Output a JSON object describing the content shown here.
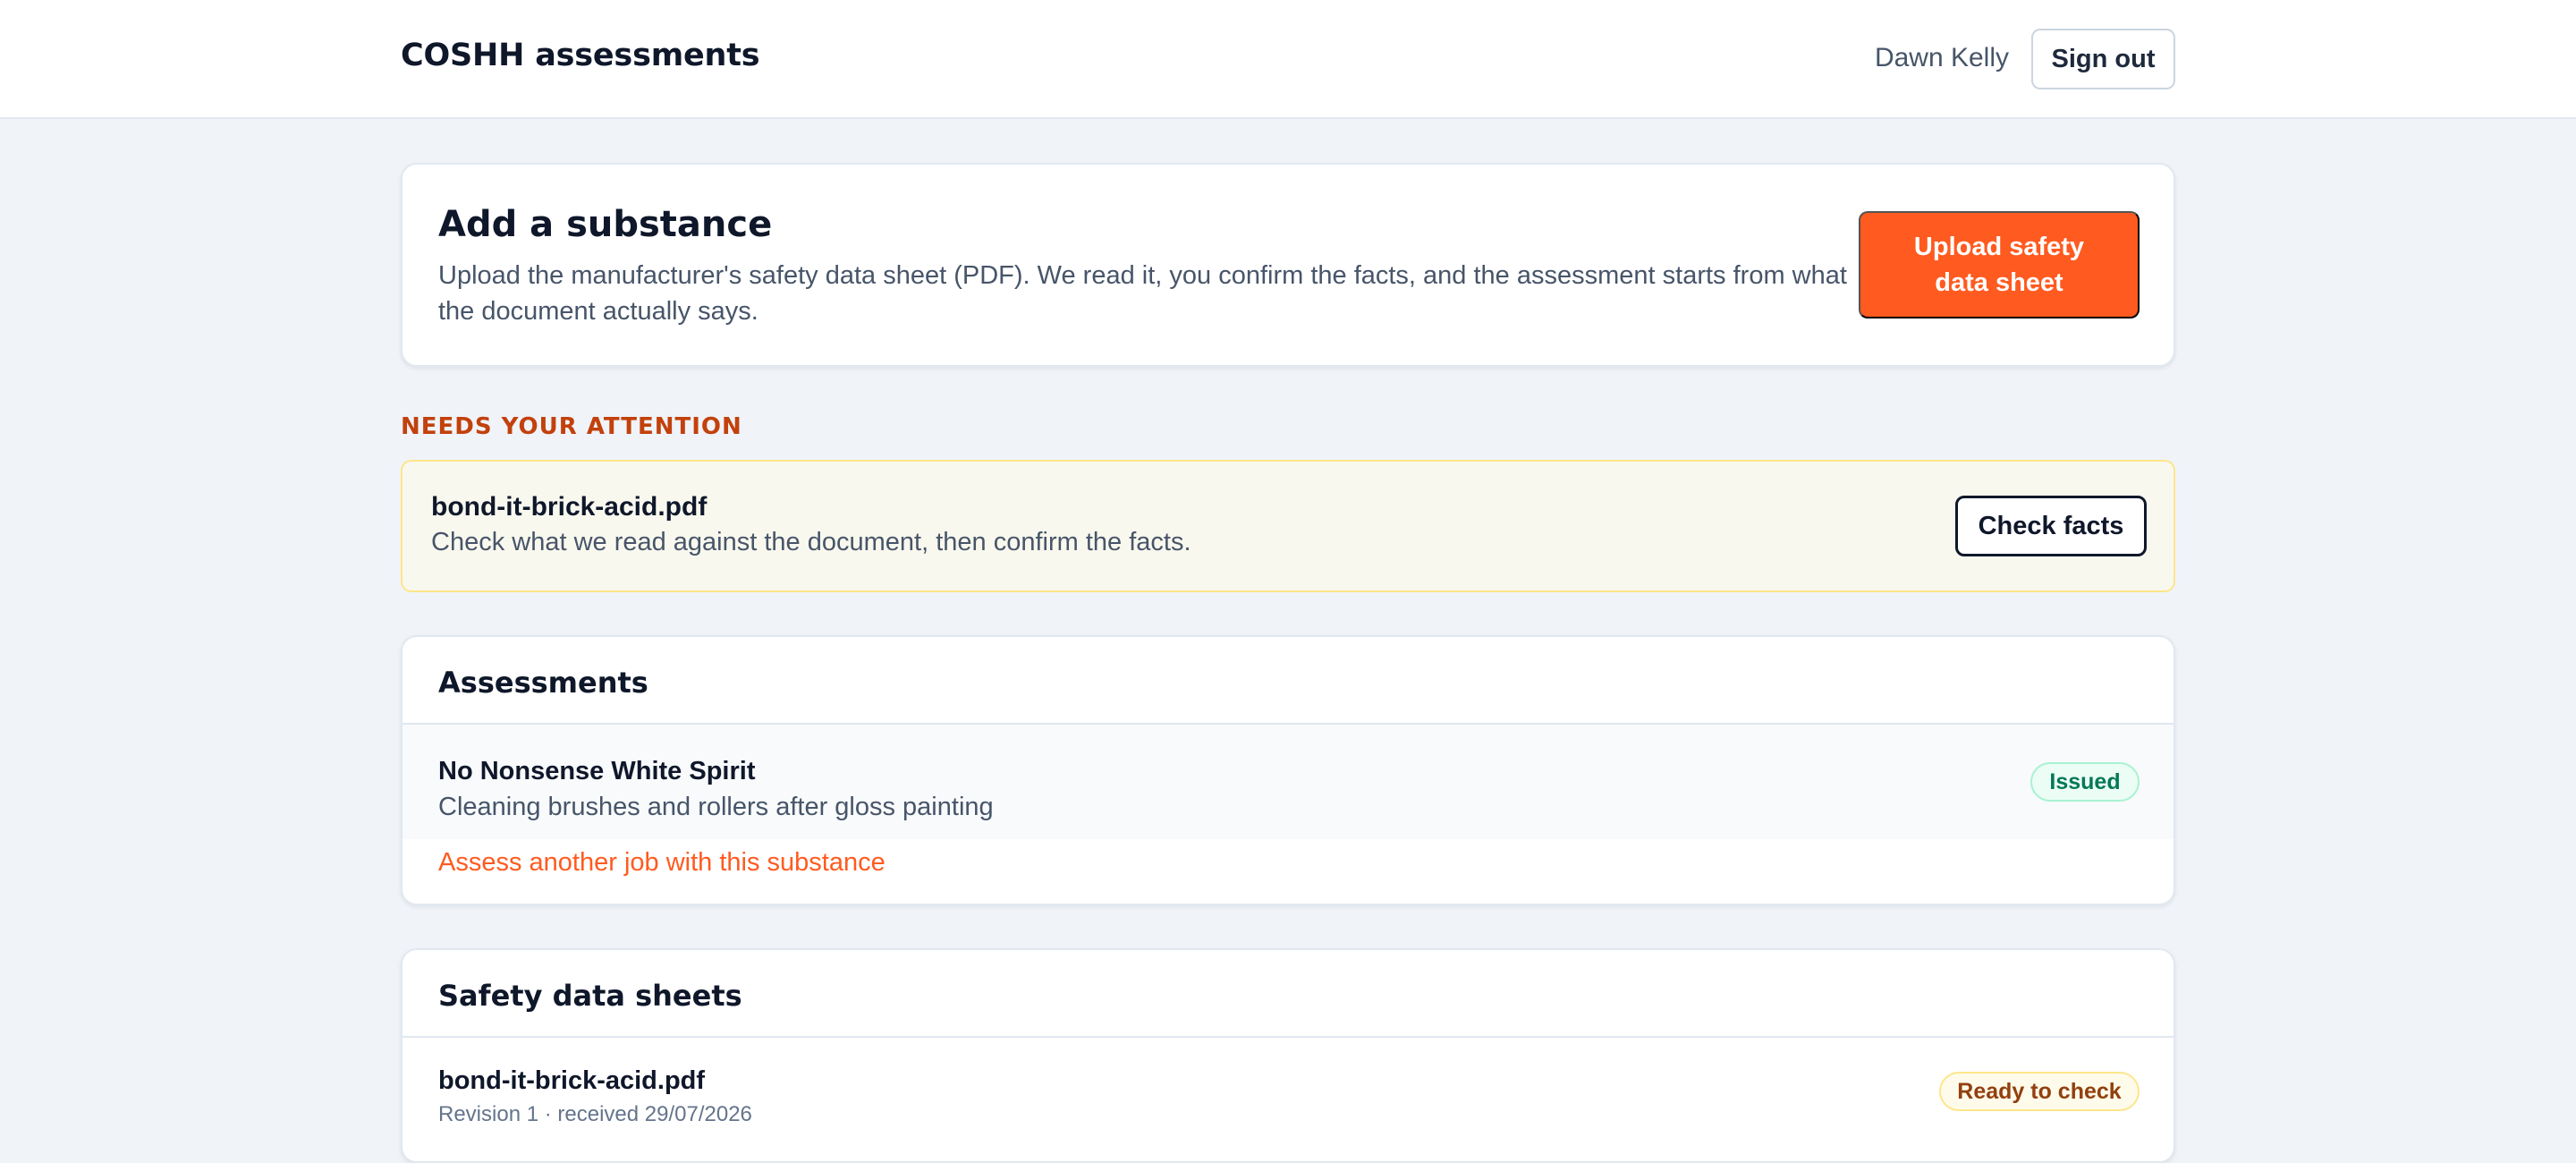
{
  "header": {
    "app_title": "COSHH assessments",
    "user_name": "Dawn Kelly",
    "signout_label": "Sign out"
  },
  "add_substance": {
    "title": "Add a substance",
    "description": "Upload the manufacturer's safety data sheet (PDF). We read it, you confirm the facts, and the assessment starts from what the document actually says.",
    "upload_label": "Upload safety data sheet"
  },
  "attention": {
    "heading": "NEEDS YOUR ATTENTION",
    "items": [
      {
        "file": "bond-it-brick-acid.pdf",
        "message": "Check what we read against the document, then confirm the facts.",
        "action_label": "Check facts"
      }
    ]
  },
  "assessments": {
    "title": "Assessments",
    "items": [
      {
        "substance": "No Nonsense White Spirit",
        "job": "Cleaning brushes and rollers after gloss painting",
        "status": "Issued",
        "link_label": "Assess another job with this substance"
      }
    ]
  },
  "safety_data_sheets": {
    "title": "Safety data sheets",
    "items": [
      {
        "file": "bond-it-brick-acid.pdf",
        "meta": "Revision 1 · received 29/07/2026",
        "status": "Ready to check"
      }
    ]
  },
  "colors": {
    "accent": "#ff5a1f",
    "attention_heading": "#c2410c",
    "page_background": "#f0f3f8",
    "issued_badge_text": "#047857",
    "ready_badge_text": "#92400e"
  }
}
